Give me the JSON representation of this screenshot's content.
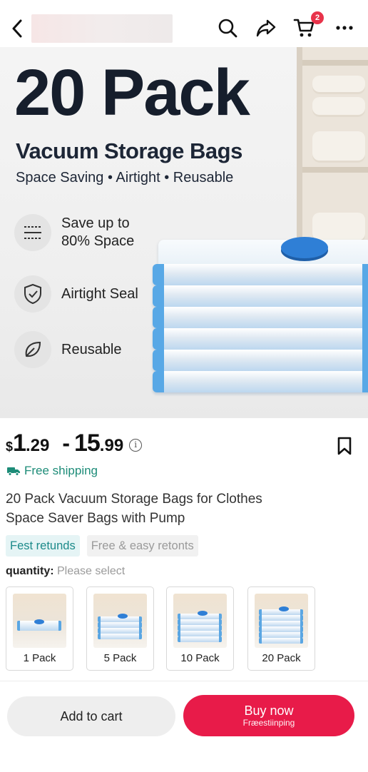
{
  "header": {
    "back_icon": "chevron-left-icon",
    "search_icon": "search-icon",
    "share_icon": "share-icon",
    "cart_icon": "cart-icon",
    "cart_badge": "2",
    "more_icon": "more-icon"
  },
  "hero": {
    "title": "20 Pack",
    "subtitle": "Vacuum Storage Bags",
    "tagline": "Space Saving • Airtight • Reusable",
    "features": [
      {
        "icon": "compress-icon",
        "line1": "Save up to",
        "line2": "80% Space"
      },
      {
        "icon": "shield-icon",
        "line1": "Airtight Seal",
        "line2": ""
      },
      {
        "icon": "leaf-icon",
        "line1": "Reusable",
        "line2": ""
      }
    ]
  },
  "price": {
    "currency": "$",
    "low_int": "1",
    "low_dec": ".29",
    "dash": "-",
    "high_int": "15",
    "high_dec": ".99",
    "info_icon": "i"
  },
  "shipping": {
    "label": "Free shipping"
  },
  "product": {
    "title_line1": "20 Pack Vacuum Storage Bags for Clothes",
    "title_line2": "Space Saver Bags with Pump"
  },
  "tags": [
    "Fest retunds",
    "Free & easy retonts"
  ],
  "quantity": {
    "label": "quantity:",
    "placeholder": "Please select"
  },
  "options": [
    "1 Pack",
    "5 Pack",
    "10 Pack",
    "20 Pack"
  ],
  "actions": {
    "add_to_cart": "Add to cart",
    "buy_now": "Buy now",
    "buy_now_sub": "Fræestiinping"
  },
  "colors": {
    "accent": "#e81b49",
    "shipping": "#1d8c78",
    "badge": "#e8334a"
  }
}
